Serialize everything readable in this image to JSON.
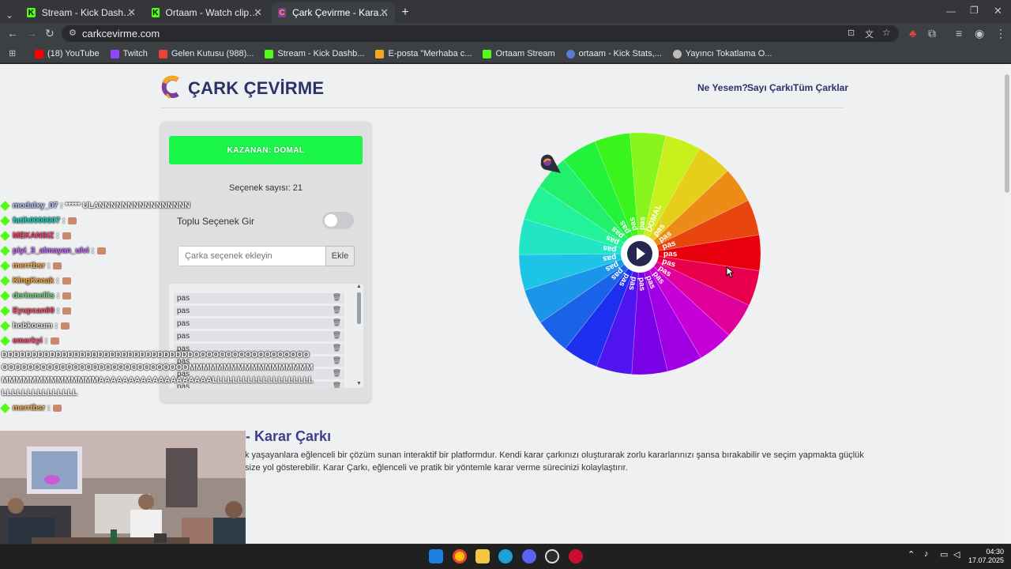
{
  "browser": {
    "tabs": [
      {
        "title": "Stream - Kick Dashboard",
        "active": false
      },
      {
        "title": "Ortaam - Watch clips on Kick",
        "active": false
      },
      {
        "title": "Çark Çevirme - Karar Çarkı",
        "active": true
      }
    ],
    "url": "carkcevirme.com",
    "bookmarks": [
      "(18) YouTube",
      "Twitch",
      "Gelen Kutusu (988)...",
      "Stream - Kick Dashb...",
      "E-posta \"Merhaba c...",
      "Ortaam Stream",
      "ortaam - Kick Stats,...",
      "Yayıncı Tokatlama O..."
    ]
  },
  "site": {
    "brand": "ÇARK ÇEVİRME",
    "nav": [
      "Ne Yesem?",
      "Sayı Çarkı",
      "Tüm Çarklar"
    ],
    "winner_text": "KAZANAN: DOMAL",
    "option_count_text": "Seçenek sayısı: 21",
    "bulk_label": "Toplu Seçenek Gir",
    "bulk_enabled": false,
    "add_placeholder": "Çarka seçenek ekleyin",
    "add_button": "Ekle",
    "options": [
      "pas",
      "pas",
      "pas",
      "pas",
      "pas",
      "pas",
      "pas",
      "pas"
    ],
    "heading": "e - Karar Çarkı",
    "paragraph_line1": "k yaşayanlara eğlenceli bir çözüm sunan interaktif bir platformdur. Kendi karar çarkınızı oluşturarak zorlu kararlarınızı şansa bırakabilir ve seçim yapmakta güçlük",
    "paragraph_line2": "size yol gösterebilir. Karar Çarkı, eğlenceli ve pratik bir yöntemle karar verme sürecinizi kolaylaştırır."
  },
  "wheel": {
    "labels": [
      "pas",
      "pas",
      "pas",
      "pas",
      "pas",
      "pas",
      "pas",
      "pas",
      "pas",
      "pas",
      "pas",
      "pas",
      "pas",
      "pas",
      "pas",
      "pas",
      "pas",
      "DOMAL",
      "pas",
      "pas",
      "pas"
    ],
    "colors": [
      "#e8000f",
      "#e8004c",
      "#e0009a",
      "#c800d8",
      "#a100e4",
      "#7a00e6",
      "#4f14f0",
      "#1e2ff0",
      "#1a63e8",
      "#1b95e8",
      "#1dc4e6",
      "#21e5c4",
      "#22f29a",
      "#22f06c",
      "#22f23a",
      "#39f51c",
      "#8af51c",
      "#c9f01c",
      "#e6cf1a",
      "#ec8c16",
      "#e8450f"
    ],
    "spin_icon": "play-icon",
    "pointer_icon": "map-pin-icon"
  },
  "chat": [
    {
      "user": "modalxy_07",
      "message": ": ***** ULANNNNNNNNNNNNNNNN",
      "color": "#b6c1ff"
    },
    {
      "user": "fatih0000007",
      "message": ":",
      "color": "#14e0c8"
    },
    {
      "user": "MEKANSIZ",
      "message": ":",
      "color": "#ff3f6c"
    },
    {
      "user": "piyi_3_almayan_ulvi",
      "message": ":",
      "color": "#c86cff"
    },
    {
      "user": "merrtbsr",
      "message": ":",
      "color": "#ffb347"
    },
    {
      "user": "KingKocak",
      "message": ":",
      "color": "#ffa02b"
    },
    {
      "user": "derinmeliis",
      "message": ":",
      "color": "#7ee08a"
    },
    {
      "user": "Eyupcan00",
      "message": ":",
      "color": "#ff4f6d"
    },
    {
      "user": "hobkocum",
      "message": ":",
      "color": "#e8e8e8"
    },
    {
      "user": "emerkyi",
      "message": ":",
      "color": "#ff4f6d"
    }
  ],
  "chat_spam": "DDDDDDDDDDDDDDDDDDDDDDDDDDDDDDDDOOOOOOOOOOOOOOOOOOOOOOOOOOOOOOOOOOOOOOOOOOOOOOOMMMMMMMMMMMMMMMMMMMMMMMMMMMMMMMMAAAAAAAAAAAAAAAAAAALLLLLLLLLLLLLLLLLLLLLLLLLLLLLLLLLLL",
  "chat_after": [
    {
      "user": "merrtbsr",
      "message": ":",
      "color": "#ffb347"
    }
  ],
  "taskbar": {
    "time": "04:30",
    "date": "17.07.2025"
  }
}
